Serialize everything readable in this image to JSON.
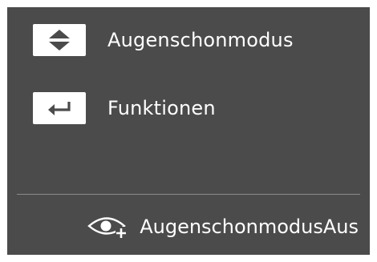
{
  "colors": {
    "panel": "#4b4b4b",
    "key_background": "#ffffff",
    "key_glyph": "#4b4b4b",
    "text": "#ffffff",
    "divider": "#8a8a8a"
  },
  "menu": {
    "items": [
      {
        "icon": "up-down-arrows-icon",
        "label": "Augenschonmodus"
      },
      {
        "icon": "enter-return-icon",
        "label": "Funktionen"
      }
    ]
  },
  "status": {
    "icon": "eye-saver-plus-icon",
    "text": "AugenschonmodusAus"
  }
}
